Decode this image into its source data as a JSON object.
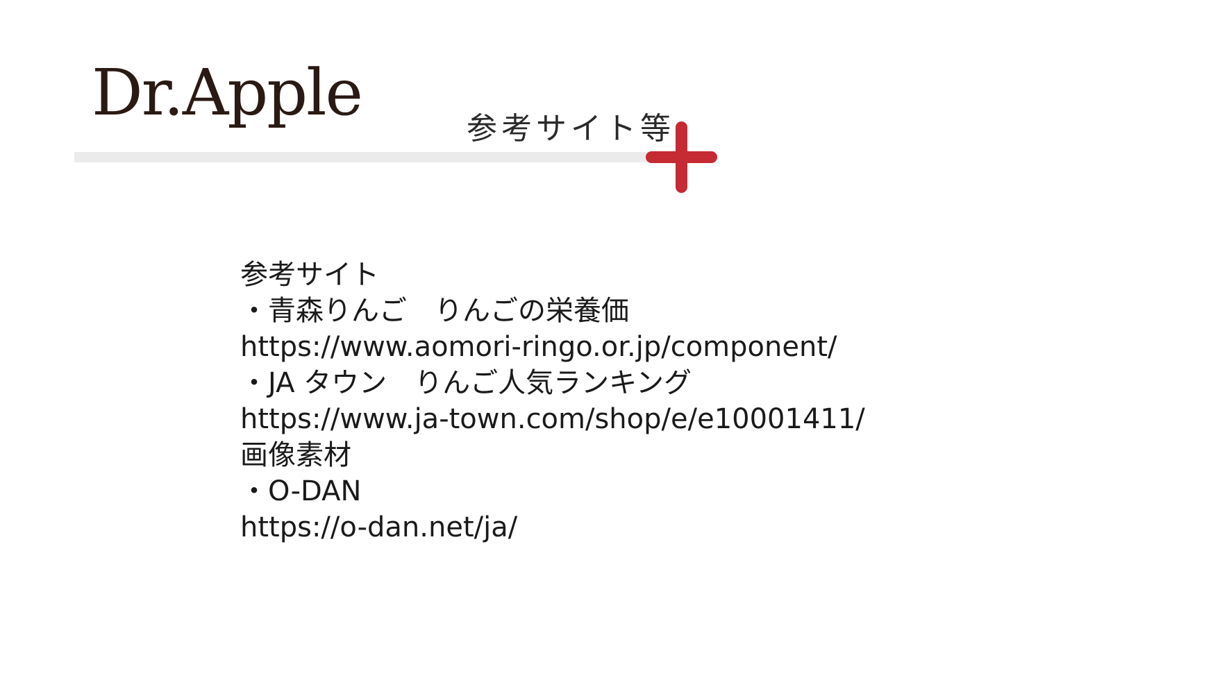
{
  "header": {
    "brand": "Dr.Apple",
    "section_title": "参考サイト等"
  },
  "icons": {
    "plus": "plus-icon"
  },
  "colors": {
    "accent": "#c62a32",
    "rule": "#ebebeb",
    "text": "#1a1a1a",
    "brand": "#2a1a14"
  },
  "references": {
    "lines": [
      "参考サイト",
      "・青森りんご　りんごの栄養価",
      "https://www.aomori-ringo.or.jp/component/",
      "・JA タウン　りんご人気ランキング",
      "https://www.ja-town.com/shop/e/e10001411/",
      "画像素材",
      "・O-DAN",
      "https://o-dan.net/ja/"
    ]
  }
}
